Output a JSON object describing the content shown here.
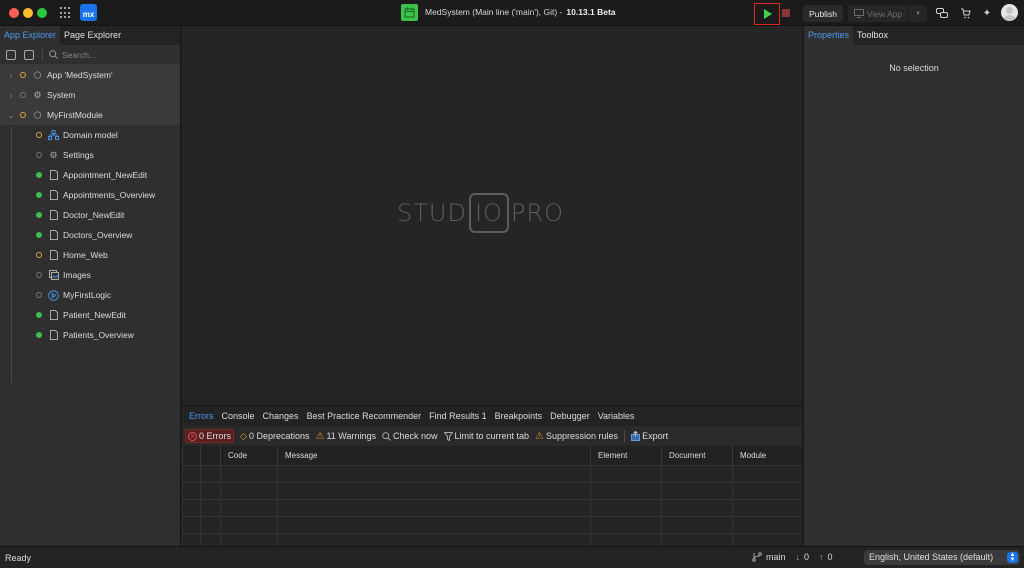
{
  "titlebar": {
    "app_logo": "mx",
    "title": "MedSystem (Main line ('main'), Git) -",
    "version": "10.13.1 Beta",
    "publish_label": "Publish",
    "view_app_label": "View App",
    "icons": [
      "apps-grid-icon",
      "calendar-icon",
      "play-icon",
      "stop-icon",
      "monitor-icon",
      "chat-icon",
      "cart-icon",
      "sparkle-icon",
      "avatar"
    ]
  },
  "left_panel": {
    "tabs": [
      {
        "label": "App Explorer",
        "active": true
      },
      {
        "label": "Page Explorer",
        "active": false
      }
    ],
    "search_placeholder": "Search...",
    "tree": [
      {
        "label": "App 'MedSystem'",
        "expanded": false,
        "status": "orange",
        "icon": "cube-icon",
        "level": 0
      },
      {
        "label": "System",
        "expanded": false,
        "status": "grey",
        "icon": "system-icon",
        "level": 0
      },
      {
        "label": "MyFirstModule",
        "expanded": true,
        "status": "orange",
        "icon": "module-icon",
        "level": 0
      },
      {
        "label": "Domain model",
        "status": "orange",
        "icon": "domain-model-icon",
        "level": 1
      },
      {
        "label": "Settings",
        "status": "grey",
        "icon": "gear-icon",
        "level": 1
      },
      {
        "label": "Appointment_NewEdit",
        "status": "green",
        "icon": "page-icon",
        "level": 1
      },
      {
        "label": "Appointments_Overview",
        "status": "green",
        "icon": "page-icon",
        "level": 1
      },
      {
        "label": "Doctor_NewEdit",
        "status": "green",
        "icon": "page-icon",
        "level": 1
      },
      {
        "label": "Doctors_Overview",
        "status": "green",
        "icon": "page-icon",
        "level": 1
      },
      {
        "label": "Home_Web",
        "status": "orange",
        "icon": "page-icon",
        "level": 1
      },
      {
        "label": "Images",
        "status": "grey",
        "icon": "images-icon",
        "level": 1
      },
      {
        "label": "MyFirstLogic",
        "status": "grey",
        "icon": "microflow-icon",
        "level": 1
      },
      {
        "label": "Patient_NewEdit",
        "status": "green",
        "icon": "page-icon",
        "level": 1
      },
      {
        "label": "Patients_Overview",
        "status": "green",
        "icon": "page-icon",
        "level": 1
      }
    ]
  },
  "center": {
    "logo_left": "STUD",
    "logo_boxed": "IO",
    "logo_right": "PRO"
  },
  "bottom_pane": {
    "tabs": [
      {
        "label": "Errors",
        "active": true
      },
      {
        "label": "Console"
      },
      {
        "label": "Changes"
      },
      {
        "label": "Best Practice Recommender"
      },
      {
        "label": "Find Results 1"
      },
      {
        "label": "Breakpoints"
      },
      {
        "label": "Debugger"
      },
      {
        "label": "Variables"
      }
    ],
    "toolbar": {
      "errors": "0 Errors",
      "deprecations": "0 Deprecations",
      "warnings": "11 Warnings",
      "check_now": "Check now",
      "limit": "Limit to current tab",
      "suppression": "Suppression rules",
      "export": "Export"
    },
    "columns": [
      "",
      "",
      "Code",
      "Message",
      "Element",
      "Document",
      "Module"
    ],
    "rows": []
  },
  "right_panel": {
    "tabs": [
      {
        "label": "Properties",
        "active": true
      },
      {
        "label": "Toolbox",
        "active": false
      }
    ],
    "empty_text": "No selection"
  },
  "statusbar": {
    "status": "Ready",
    "branch": "main",
    "incoming": "0",
    "outgoing": "0",
    "language": "English, United States (default)"
  },
  "colors": {
    "accent": "#4a9bf0",
    "run_green": "#3fcf4a",
    "highlight_red": "#e0281e",
    "status_green": "#3fbf4a",
    "status_orange": "#d9a53a"
  }
}
